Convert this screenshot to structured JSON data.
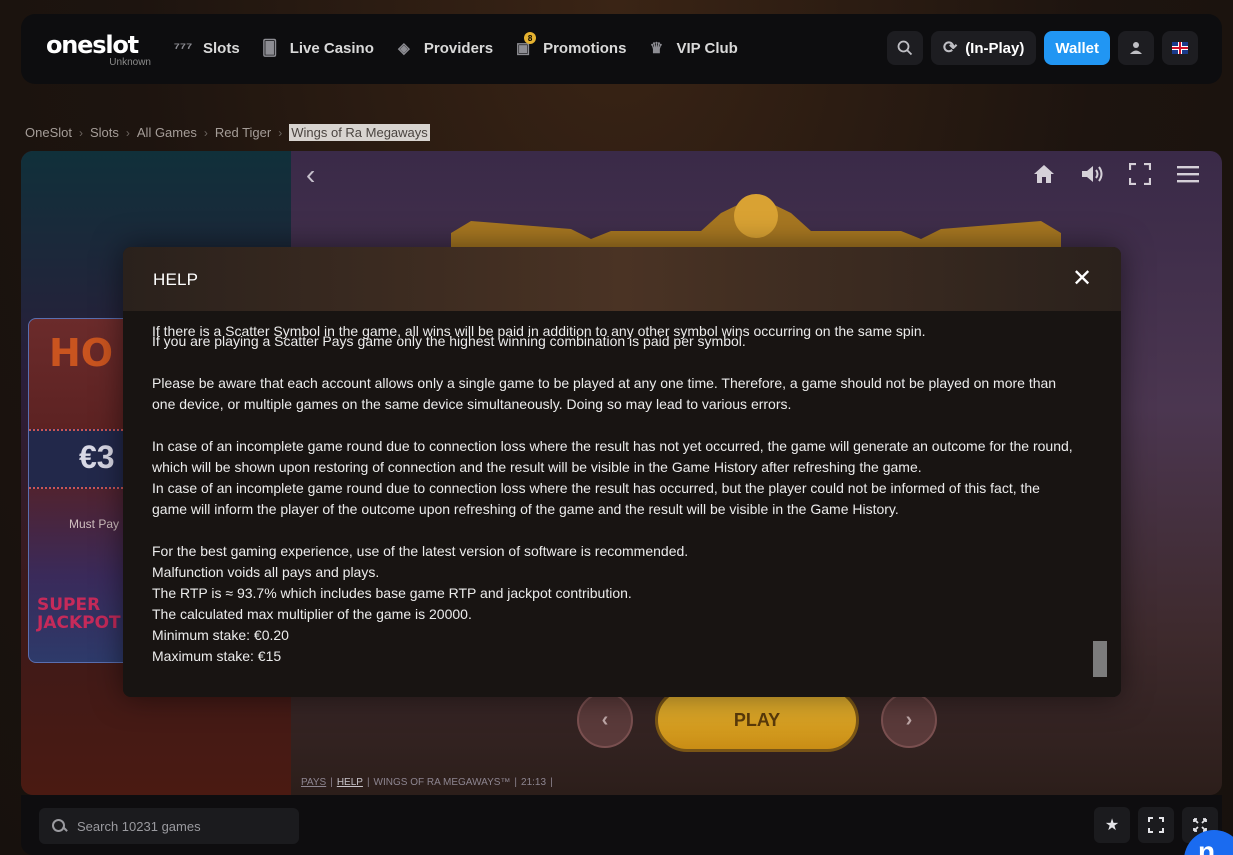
{
  "logo": {
    "name": "oneslot",
    "sub": "Unknown"
  },
  "nav": {
    "items": [
      {
        "label": "Slots",
        "icon": "777"
      },
      {
        "label": "Live Casino",
        "icon": "cards"
      },
      {
        "label": "Providers",
        "icon": "layers"
      },
      {
        "label": "Promotions",
        "icon": "gift",
        "badge": "8"
      },
      {
        "label": "VIP Club",
        "icon": "crown"
      }
    ],
    "inplay_label": "(In-Play)",
    "wallet_label": "Wallet"
  },
  "breadcrumb": {
    "items": [
      "OneSlot",
      "Slots",
      "All Games",
      "Red Tiger"
    ],
    "current": "Wings of Ra Megaways"
  },
  "left_panel": {
    "hot": "HO",
    "euro": "€3",
    "must_pay": "Must Pay",
    "super": "SUPER",
    "jackpot": "JACKPOT"
  },
  "game": {
    "play_label": "PLAY",
    "footer": {
      "pays": "PAYS",
      "help": "HELP",
      "title": "WINGS OF RA MEGAWAYS™",
      "time": "21:13"
    }
  },
  "help": {
    "title": "HELP",
    "close": "✕",
    "clipped_line": "If there is a Scatter Symbol in the game, all wins will be paid in addition to any other symbol wins occurring on the same spin.",
    "lines": [
      "If you are playing a Scatter Pays game only the highest winning combination is paid per symbol.",
      "",
      "Please be aware that each account allows only a single game to be played at any one time. Therefore, a game should not be played on more than",
      "one device, or multiple games on the same device simultaneously. Doing so may lead to various errors.",
      "",
      "In case of an incomplete game round due to connection loss where the result has not yet occurred, the game will generate an outcome for the round,",
      "which will be shown upon restoring of connection and the result will be visible in the Game History after refreshing the game.",
      "In case of an incomplete game round due to connection loss where the result has occurred, but the player could not be informed of this fact, the",
      "game will inform the player of the outcome upon refreshing of the game and the result will be visible in the Game History.",
      "",
      "For the best gaming experience, use of the latest version of software is recommended.",
      "Malfunction voids all pays and plays.",
      "The RTP is ≈ 93.7% which includes base game RTP and jackpot contribution.",
      "The calculated max multiplier of the game is 20000.",
      "Minimum stake: €0.20",
      "Maximum stake: €15"
    ]
  },
  "bottom": {
    "search_placeholder": "Search 10231 games"
  },
  "chat_bubble_letter": "n",
  "colors": {
    "accent": "#2196f3",
    "background": "#1f1510",
    "modal": "#181412",
    "play_button": "#e6b532"
  }
}
